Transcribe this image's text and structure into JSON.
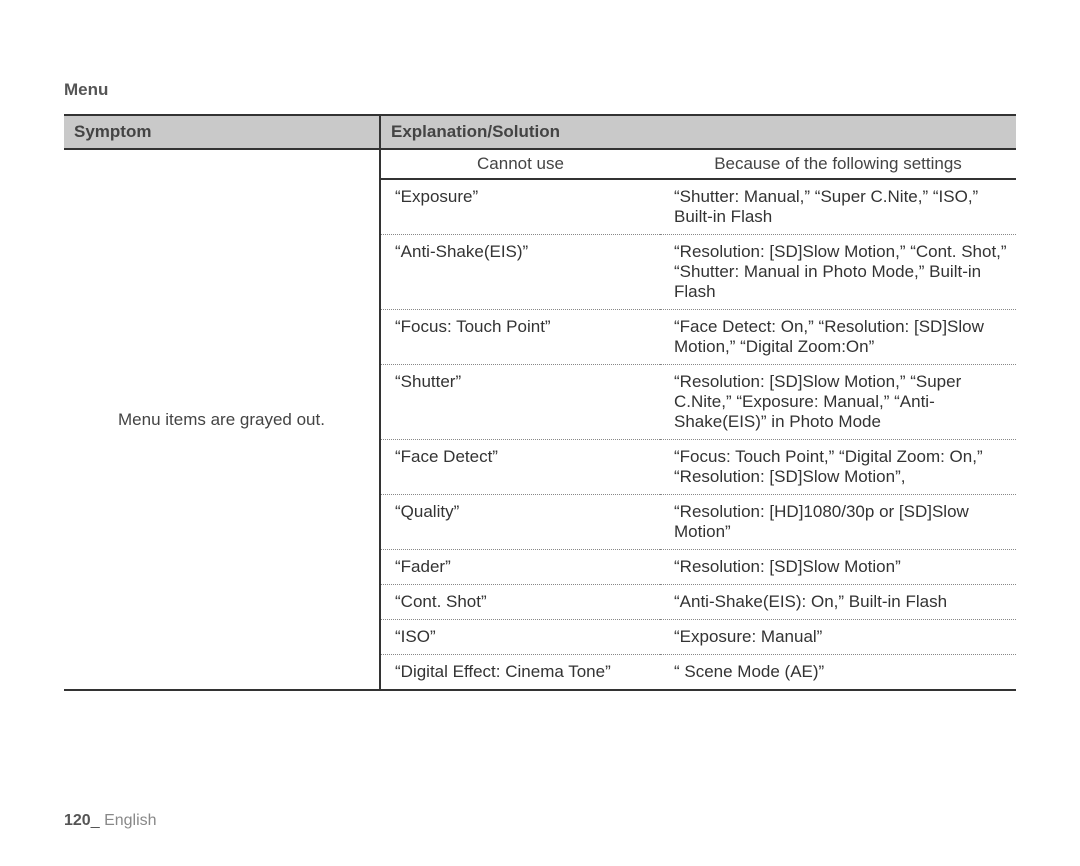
{
  "section_title": "Menu",
  "col1_header": "Symptom",
  "col2_header": "Explanation/Solution",
  "symptom": "Menu items are grayed out.",
  "subhead_left": "Cannot use",
  "subhead_right": "Because of the following settings",
  "rows": [
    {
      "left": "“Exposure”",
      "right": "“Shutter: Manual,” “Super C.Nite,” “ISO,” Built-in Flash"
    },
    {
      "left": "“Anti-Shake(EIS)”",
      "right": "“Resolution: [SD]Slow Motion,” “Cont. Shot,” “Shutter: Manual in Photo Mode,” Built-in Flash"
    },
    {
      "left": "“Focus: Touch Point”",
      "right": "“Face Detect: On,” “Resolution: [SD]Slow Motion,” “Digital Zoom:On”"
    },
    {
      "left": "“Shutter”",
      "right": "“Resolution: [SD]Slow Motion,” “Super C.Nite,” “Exposure: Manual,” “Anti-Shake(EIS)” in Photo Mode"
    },
    {
      "left": "“Face Detect”",
      "right": "“Focus: Touch Point,” “Digital Zoom: On,” “Resolution: [SD]Slow Motion”,"
    },
    {
      "left": "“Quality”",
      "right": "“Resolution: [HD]1080/30p or [SD]Slow Motion”"
    },
    {
      "left": "“Fader”",
      "right": "“Resolution: [SD]Slow Motion”"
    },
    {
      "left": "“Cont. Shot”",
      "right": "“Anti-Shake(EIS): On,” Built-in Flash"
    },
    {
      "left": "“ISO”",
      "right": "“Exposure: Manual”"
    },
    {
      "left": "“Digital Effect: Cinema Tone”",
      "right": "“ Scene Mode (AE)”"
    }
  ],
  "footer": {
    "page": "120",
    "underscore": "_",
    "lang": "English"
  }
}
